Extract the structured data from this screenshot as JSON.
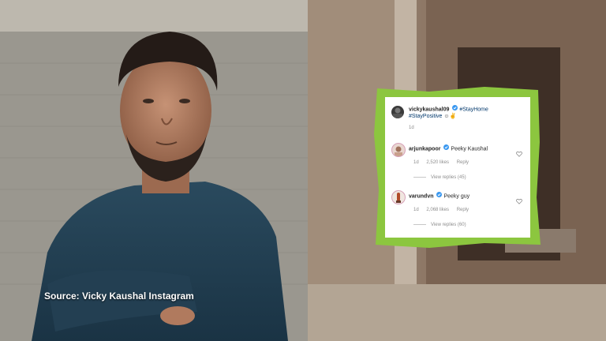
{
  "caption": {
    "source": "Source: Vicky Kaushal Instagram"
  },
  "post": {
    "username": "vickykaushal09",
    "hashtag1": "#StayHome",
    "hashtag2": "#StayPositive",
    "emojis": "☺✌",
    "time": "1d"
  },
  "comments": [
    {
      "username": "arjunkapoor",
      "text": "Peeky Kaushal",
      "time": "1d",
      "likes": "2,520 likes",
      "reply": "Reply",
      "view_replies": "View replies (45)"
    },
    {
      "username": "varundvn",
      "text": "Peeky guy",
      "time": "1d",
      "likes": "2,068 likes",
      "reply": "Reply",
      "view_replies": "View replies (60)"
    }
  ],
  "colors": {
    "frame_green": "#8cc63f",
    "verified_blue": "#3897f0",
    "hashtag_blue": "#00376b",
    "meta_gray": "#8e8e8e"
  },
  "icons": [
    "verified-badge-icon",
    "heart-outline-icon"
  ]
}
